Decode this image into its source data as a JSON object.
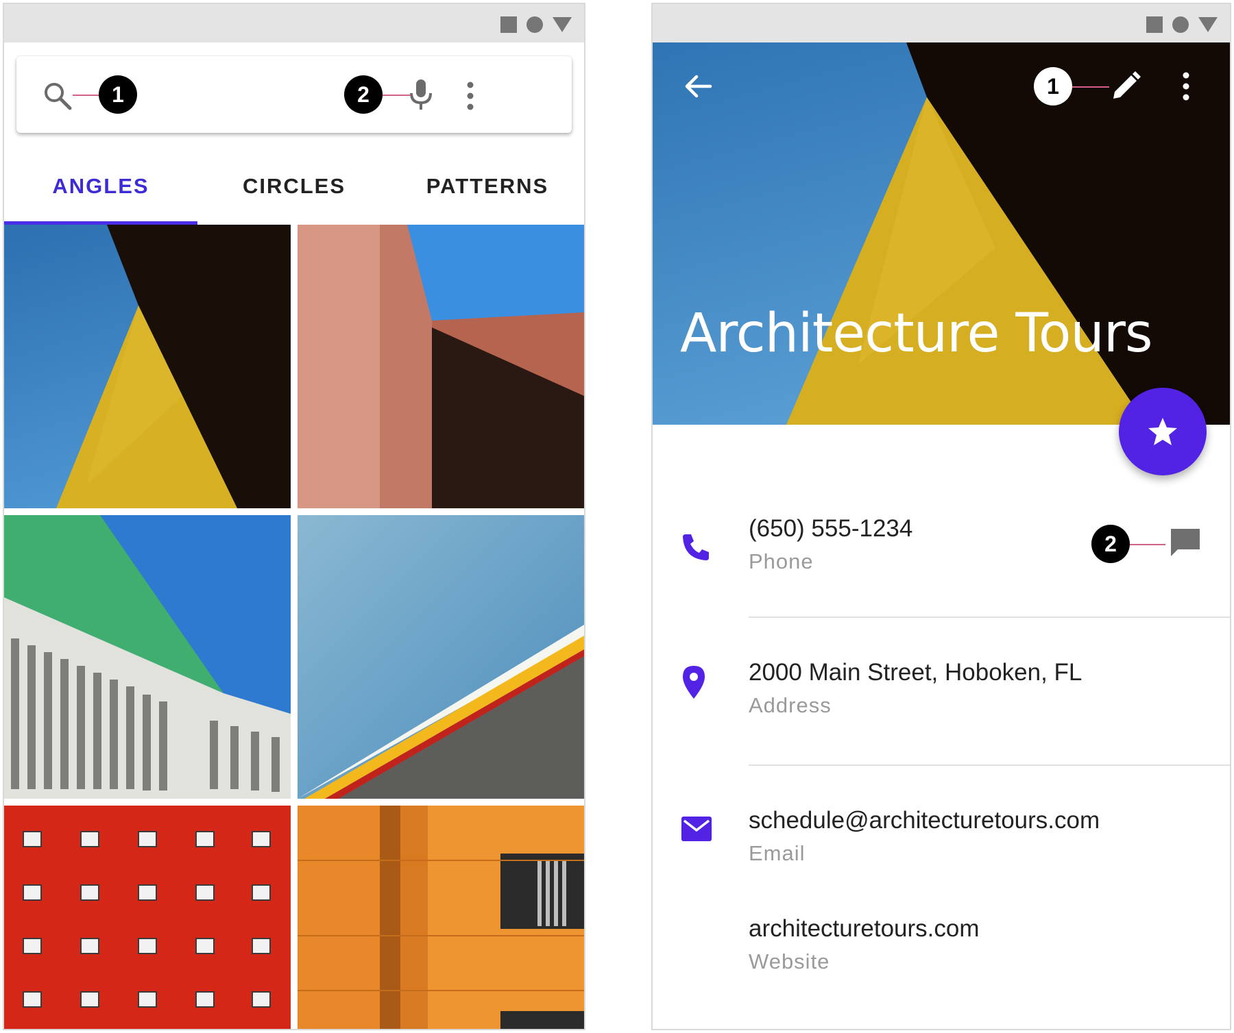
{
  "left_screen": {
    "search": {
      "callout_search": "1",
      "callout_mic": "2"
    },
    "tabs": [
      {
        "label": "ANGLES",
        "active": true
      },
      {
        "label": "CIRCLES",
        "active": false
      },
      {
        "label": "PATTERNS",
        "active": false
      }
    ],
    "image_grid": [
      "yellow-triangle-wall",
      "pink-wall-corner",
      "green-glass-building",
      "sky-stripe-roof",
      "red-window-facade",
      "orange-facade"
    ]
  },
  "right_screen": {
    "title": "Architecture Tours",
    "callout_edit": "1",
    "callout_message": "2",
    "contacts": [
      {
        "primary": "(650) 555-1234",
        "secondary": "Phone",
        "icon": "phone-icon"
      },
      {
        "primary": "2000 Main Street, Hoboken, FL",
        "secondary": "Address",
        "icon": "location-pin-icon"
      },
      {
        "primary": "schedule@architecturetours.com",
        "secondary": "Email",
        "icon": "email-icon"
      },
      {
        "primary": "architecturetours.com",
        "secondary": "Website",
        "icon": ""
      }
    ]
  },
  "colors": {
    "accent": "#5222e5",
    "callout_line": "#d65f8a",
    "status_bar": "#e4e4e4"
  }
}
